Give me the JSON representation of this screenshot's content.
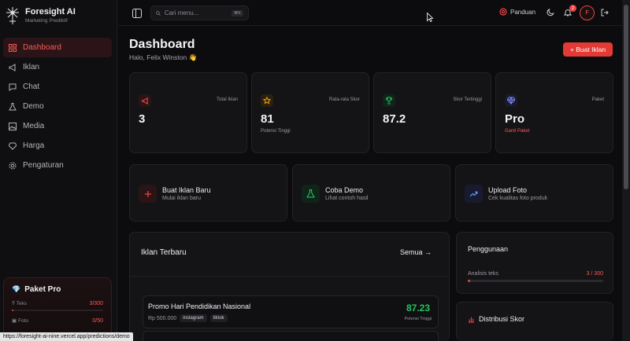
{
  "brand": {
    "title": "Foresight AI",
    "subtitle": "Marketing Prediktif"
  },
  "sidebar": {
    "items": [
      {
        "label": "Dashboard",
        "icon": "grid-icon"
      },
      {
        "label": "Iklan",
        "icon": "megaphone-icon"
      },
      {
        "label": "Chat",
        "icon": "chat-icon"
      },
      {
        "label": "Demo",
        "icon": "flask-icon"
      },
      {
        "label": "Media",
        "icon": "image-icon"
      },
      {
        "label": "Harga",
        "icon": "gem-icon"
      },
      {
        "label": "Pengaturan",
        "icon": "gear-icon"
      }
    ],
    "pro_card": {
      "title": "Paket Pro",
      "quotas": [
        {
          "label": "Teks",
          "value": "3/300",
          "fraction": 0.01
        },
        {
          "label": "Foto",
          "value": "0/50",
          "fraction": 0
        }
      ]
    }
  },
  "topbar": {
    "search_placeholder": "Cari menu...",
    "shortcut": "⌘K",
    "guide_label": "Panduan",
    "notification_count": "2",
    "avatar_initial": "F"
  },
  "header": {
    "title": "Dashboard",
    "greeting": "Halo, Felix Winston 👋",
    "create_button": "+ Buat Iklan"
  },
  "stats": [
    {
      "label": "Total Iklan",
      "value": "3",
      "note": ""
    },
    {
      "label": "Rata-rata Skor",
      "value": "81",
      "note": "Potensi Tinggi"
    },
    {
      "label": "Skor Tertinggi",
      "value": "87.2",
      "note": ""
    },
    {
      "label": "Paket",
      "value": "Pro",
      "note": "Ganti Paket"
    }
  ],
  "actions": [
    {
      "title": "Buat Iklan Baru",
      "subtitle": "Mulai iklan baru"
    },
    {
      "title": "Coba Demo",
      "subtitle": "Lihat contoh hasil"
    },
    {
      "title": "Upload Foto",
      "subtitle": "Cek kualitas foto produk"
    }
  ],
  "recent": {
    "title": "Iklan Terbaru",
    "link": "Semua →",
    "items": [
      {
        "title": "Promo Hari Pendidikan Nasional",
        "price": "Rp 500.000",
        "tags": [
          "instagram",
          "tiktok"
        ],
        "score": "87.23",
        "score_label": "Potensi Tinggi"
      }
    ]
  },
  "usage": {
    "title": "Penggunaan",
    "label": "Analisis teks",
    "value": "3 / 300",
    "fraction": 0.01
  },
  "distribution": {
    "title": "Distribusi Skor"
  },
  "status_url": "https://foresight-ai-nine.vercel.app/predictions/demo",
  "colors": {
    "accent": "#e53935",
    "success": "#22c55e",
    "background": "#0c0c0e"
  }
}
